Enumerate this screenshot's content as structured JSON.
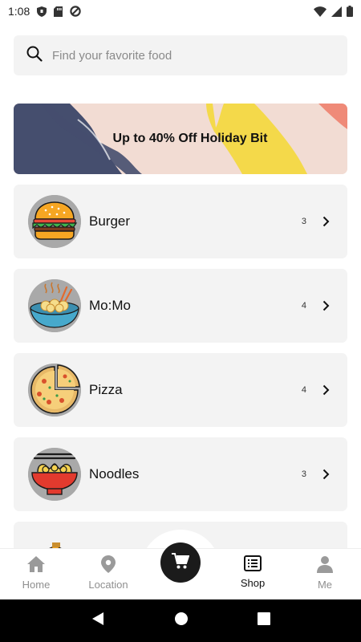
{
  "status_bar": {
    "time": "1:08"
  },
  "search": {
    "placeholder": "Find your favorite food"
  },
  "banner": {
    "text": "Up to 40% Off Holiday Bit",
    "colors": {
      "background": "#f2dcd3",
      "navy": "#454e6e",
      "yellow": "#f4d94a",
      "coral": "#ef8a78"
    }
  },
  "categories": [
    {
      "name": "Burger",
      "count": "3",
      "icon": "burger-icon"
    },
    {
      "name": "Mo:Mo",
      "count": "4",
      "icon": "momo-bowl-icon"
    },
    {
      "name": "Pizza",
      "count": "4",
      "icon": "pizza-icon"
    },
    {
      "name": "Noodles",
      "count": "3",
      "icon": "noodles-icon"
    }
  ],
  "bottom_nav": {
    "items": [
      {
        "label": "Home",
        "icon": "home-icon"
      },
      {
        "label": "Location",
        "icon": "location-pin-icon"
      },
      {
        "label": "Shop",
        "icon": "list-icon",
        "active": true
      },
      {
        "label": "Me",
        "icon": "person-icon"
      }
    ],
    "fab_icon": "cart-icon"
  },
  "colors": {
    "card_bg": "#f3f3f3",
    "accent_dark": "#1b1b1b",
    "inactive": "#8f8f8f"
  }
}
